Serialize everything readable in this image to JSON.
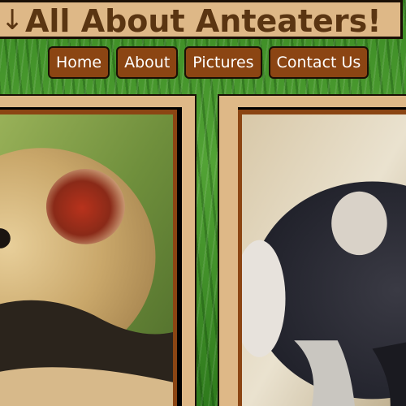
{
  "header": {
    "arrow_icon": "↓",
    "title": "All About Anteaters!"
  },
  "nav": {
    "items": [
      {
        "label": "Home"
      },
      {
        "label": "About"
      },
      {
        "label": "Pictures"
      },
      {
        "label": "Contact Us"
      }
    ]
  },
  "colors": {
    "header_bg": "#deb887",
    "title_text": "#5a3512",
    "nav_bg": "#8b4513",
    "nav_text": "#ffffff",
    "frame_border": "#8b4513",
    "background_grass": "#3b8a24"
  },
  "cards": [
    {
      "image": "tamandua-anteater-closeup-photo"
    },
    {
      "image": "anteater-back-view-photo"
    }
  ]
}
